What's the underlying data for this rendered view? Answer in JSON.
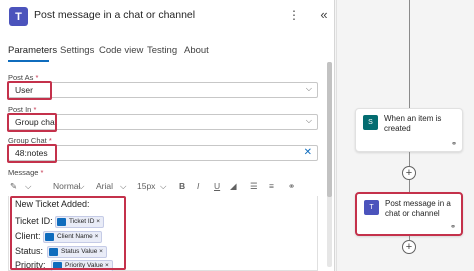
{
  "header": {
    "title": "Post message in a chat or channel",
    "more_icon": "ellipsis-icon",
    "collapse_icon": "double-chevron-left-icon"
  },
  "tabs": [
    {
      "label": "Parameters",
      "active": true
    },
    {
      "label": "Settings"
    },
    {
      "label": "Code view"
    },
    {
      "label": "Testing"
    },
    {
      "label": "About"
    }
  ],
  "fields": {
    "post_as": {
      "label": "Post As",
      "req": "*",
      "value": "User"
    },
    "post_in": {
      "label": "Post In",
      "req": "*",
      "value": "Group chat"
    },
    "group_chat": {
      "label": "Group Chat",
      "req": "*",
      "value": "48:notes"
    },
    "message": {
      "label": "Message",
      "req": "*"
    }
  },
  "toolbar": {
    "style": "Normal",
    "font": "Arial",
    "size": "15px",
    "bold": "B",
    "italic": "I",
    "underline": "U",
    "pen": "✎"
  },
  "editor": {
    "line1": "New Ticket Added:",
    "rows": [
      {
        "label": "Ticket ID:",
        "chip": "Ticket ID ×"
      },
      {
        "label": "Client:",
        "chip": "Client Name ×"
      },
      {
        "label": "Status:",
        "chip": "Status Value ×"
      },
      {
        "label": "Priority:",
        "chip": "Priority Value ×"
      }
    ]
  },
  "canvas": {
    "trigger_label": "When an item is created",
    "action_label": "Post message in a chat or channel",
    "plus": "+"
  },
  "colors": {
    "accent": "#0f6cbd",
    "highlight": "#c4314b",
    "teams": "#4b53bc",
    "sharepoint": "#036c70"
  }
}
